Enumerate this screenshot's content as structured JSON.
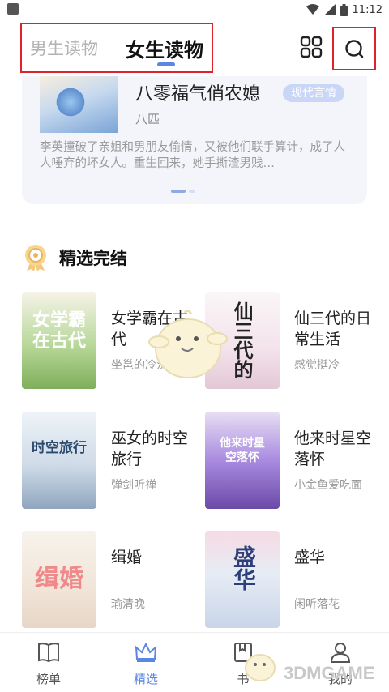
{
  "status_bar": {
    "time": "11:12"
  },
  "header": {
    "tabs": [
      {
        "label": "男生读物",
        "active": false
      },
      {
        "label": "女生读物",
        "active": true
      }
    ]
  },
  "banner": {
    "title": "八零福气俏农媳",
    "tag": "现代言情",
    "author": "八匹",
    "description": "李英撞破了亲姐和男朋友偷情，又被他们联手算计，成了人人唾弃的坏女人。重生回来，她手撕渣男贱…"
  },
  "section": {
    "title": "精选完结"
  },
  "books": [
    {
      "title": "女学霸在古代",
      "author": "坐邕的冷汾东",
      "cover_text": "女学霸 在古代",
      "cover_color": "#8fbf6a"
    },
    {
      "title": "仙三代的日常生活",
      "author": "感觉挺冷",
      "cover_text": "仙三代的",
      "cover_color": "#f4e9ee"
    },
    {
      "title": "巫女的时空旅行",
      "author": "弹剑听禅",
      "cover_text": "时空旅行",
      "cover_color": "#dce8f2"
    },
    {
      "title": "他来时星空落怀",
      "author": "小金鱼爱吃面",
      "cover_text": "他来时星空落怀",
      "cover_color": "#8b63c9"
    },
    {
      "title": "缉婚",
      "author": "瑜清晚",
      "cover_text": "缉婚",
      "cover_color": "#f1ece4"
    },
    {
      "title": "盛华",
      "author": "闲听落花",
      "cover_text": "盛华",
      "cover_color": "#dde6f3"
    }
  ],
  "bottom_nav": [
    {
      "label": "榜单",
      "icon": "book-icon",
      "active": false
    },
    {
      "label": "精选",
      "icon": "crown-icon",
      "active": true
    },
    {
      "label": "书",
      "icon": "bookshelf-icon",
      "active": false
    },
    {
      "label": "我的",
      "icon": "user-icon",
      "active": false
    }
  ],
  "watermark": {
    "text": "3DMGAME"
  }
}
